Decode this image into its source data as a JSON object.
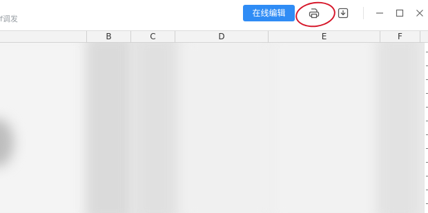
{
  "header": {
    "breadcrumb_fragment": "f调发",
    "edit_button_label": "在线编辑",
    "print_icon": "print-icon",
    "download_icon": "download-icon",
    "highlight_color": "#d6172a",
    "accent_color": "#2f8cf5"
  },
  "window_controls": {
    "minimize_icon": "minimize-icon",
    "maximize_icon": "maximize-icon",
    "close_icon": "close-icon"
  },
  "sheet": {
    "columns": [
      "B",
      "C",
      "D",
      "E",
      "F"
    ]
  }
}
